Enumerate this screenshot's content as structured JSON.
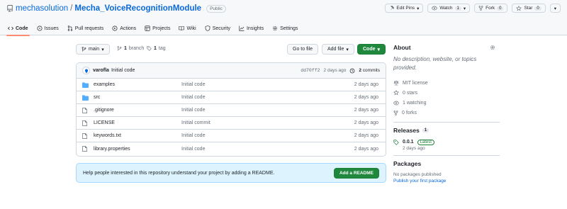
{
  "repo": {
    "owner": "mechasolution",
    "separator": "/",
    "name": "Mecha_VoiceRecognitionModule",
    "visibility": "Public"
  },
  "actions": {
    "edit_pins": "Edit Pins",
    "watch": "Watch",
    "watch_count": "1",
    "fork": "Fork",
    "fork_count": "0",
    "star": "Star",
    "star_count": "0"
  },
  "tabs": [
    {
      "label": "Code",
      "icon": "code-icon"
    },
    {
      "label": "Issues",
      "icon": "issue-icon"
    },
    {
      "label": "Pull requests",
      "icon": "pull-request-icon"
    },
    {
      "label": "Actions",
      "icon": "actions-icon"
    },
    {
      "label": "Projects",
      "icon": "projects-icon"
    },
    {
      "label": "Wiki",
      "icon": "wiki-icon"
    },
    {
      "label": "Security",
      "icon": "shield-icon"
    },
    {
      "label": "Insights",
      "icon": "graph-icon"
    },
    {
      "label": "Settings",
      "icon": "gear-icon"
    }
  ],
  "toolbar": {
    "branch": "main",
    "branches_count": "1",
    "branches_label": "branch",
    "tags_count": "1",
    "tags_label": "tag",
    "go_to_file": "Go to file",
    "add_file": "Add file",
    "code": "Code"
  },
  "commit": {
    "author": "varofla",
    "message": "Initial code",
    "hash": "dd70ff2",
    "time": "2 days ago",
    "commits_count": "2",
    "commits_label": "commits"
  },
  "files": [
    {
      "name": "examples",
      "type": "folder",
      "message": "Initial code",
      "date": "2 days ago"
    },
    {
      "name": "src",
      "type": "folder",
      "message": "Initial code",
      "date": "2 days ago"
    },
    {
      "name": ".gitignore",
      "type": "file",
      "message": "Initial code",
      "date": "2 days ago"
    },
    {
      "name": "LICENSE",
      "type": "file",
      "message": "Initial commit",
      "date": "2 days ago"
    },
    {
      "name": "keywords.txt",
      "type": "file",
      "message": "Initial code",
      "date": "2 days ago"
    },
    {
      "name": "library.properties",
      "type": "file",
      "message": "Initial code",
      "date": "2 days ago"
    }
  ],
  "readme_banner": {
    "text": "Help people interested in this repository understand your project by adding a README.",
    "button": "Add a README"
  },
  "about": {
    "title": "About",
    "description": "No description, website, or topics provided.",
    "license": "MIT license",
    "stars": "0 stars",
    "watching": "1 watching",
    "forks": "0 forks"
  },
  "releases": {
    "title": "Releases",
    "count": "1",
    "version": "0.0.1",
    "badge": "Latest",
    "date": "2 days ago"
  },
  "packages": {
    "title": "Packages",
    "none": "No packages published",
    "link": "Publish your first package"
  },
  "colors": {
    "accent": "#0969da",
    "green": "#1f883d",
    "tab_underline": "#fd8c73",
    "folder": "#54aeff"
  }
}
